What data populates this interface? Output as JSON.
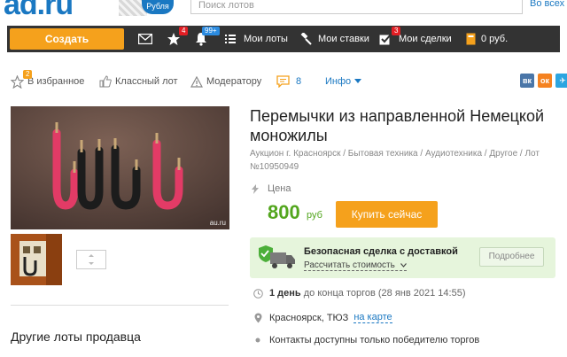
{
  "header": {
    "logo": "ad.ru",
    "logo_badge": "Рубля",
    "search_placeholder": "Поиск лотов",
    "search_link": "Во всех"
  },
  "nav": {
    "create": "Создать",
    "messages_badge": "4",
    "favorites_badge": "99+",
    "my_lots": "Мои лоты",
    "my_bids": "Мои ставки",
    "my_deals": "Мои сделки",
    "deals_badge": "3",
    "balance": "0 руб."
  },
  "actions": {
    "favorites_count": "2",
    "favorites": "В избранное",
    "class_lot": "Классный лот",
    "moderator": "Модератору",
    "comments_count": "8",
    "info": "Инфо",
    "social_vk": "вк",
    "social_ok": "ок",
    "social_tg": "✈"
  },
  "listing": {
    "title": "Перемычки из направленной Немецкой моножилы",
    "breadcrumbs": "Аукцион г. Красноярск / Бытовая техника / Аудиотехника / Другое / Лот №10950949",
    "price_label": "Цена",
    "price": "800",
    "currency": "руб",
    "buy_button": "Купить сейчас",
    "watermark": "au.ru"
  },
  "deal": {
    "title": "Безопасная сделка с доставкой",
    "calc": "Рассчитать стоимость",
    "more": "Подробнее"
  },
  "details": {
    "time_bold": "1 день",
    "time_rest": " до конца торгов",
    "time_date": " (28 янв 2021 14:55)",
    "location": "Красноярск, ТЮЗ",
    "map_link": "на карте",
    "contacts": "Контакты доступны только победителю торгов"
  },
  "sidebar": {
    "other_lots": "Другие лоты продавца"
  },
  "colors": {
    "accent_orange": "#f5a11c",
    "nav_dark": "#333333",
    "link_blue": "#1a78c2",
    "price_green": "#53a61e",
    "deal_bg": "#e6f5dc"
  }
}
